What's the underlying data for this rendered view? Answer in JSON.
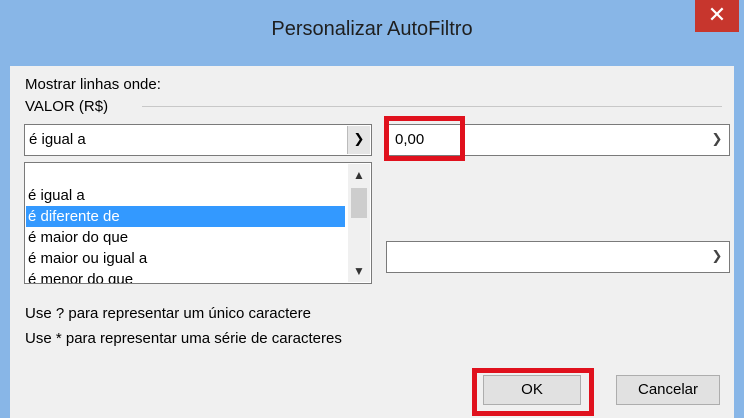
{
  "dialog": {
    "title": "Personalizar AutoFiltro",
    "close_glyph": "✕"
  },
  "group": {
    "show_rows_label": "Mostrar linhas onde:",
    "field_label": "VALOR (R$)"
  },
  "condition1": {
    "operator": "é igual a",
    "value": "0,00"
  },
  "operator_list": {
    "options": [
      "",
      "é igual a",
      "é diferente de",
      "é maior do que",
      "é maior ou igual a",
      "é menor do que"
    ],
    "selected": "é diferente de"
  },
  "condition2": {
    "value": ""
  },
  "hints": {
    "single_char": "Use ? para representar um único caractere",
    "series": "Use * para representar uma série de caracteres"
  },
  "buttons": {
    "ok": "OK",
    "cancel": "Cancelar"
  },
  "icons": {
    "dropdown": "chevron-down-icon",
    "scroll_up": "chevron-up-icon",
    "close": "close-icon"
  },
  "colors": {
    "titlebar": "#88b6e7",
    "close": "#c7362d",
    "selection": "#3399ff",
    "highlight": "#e0111d"
  }
}
